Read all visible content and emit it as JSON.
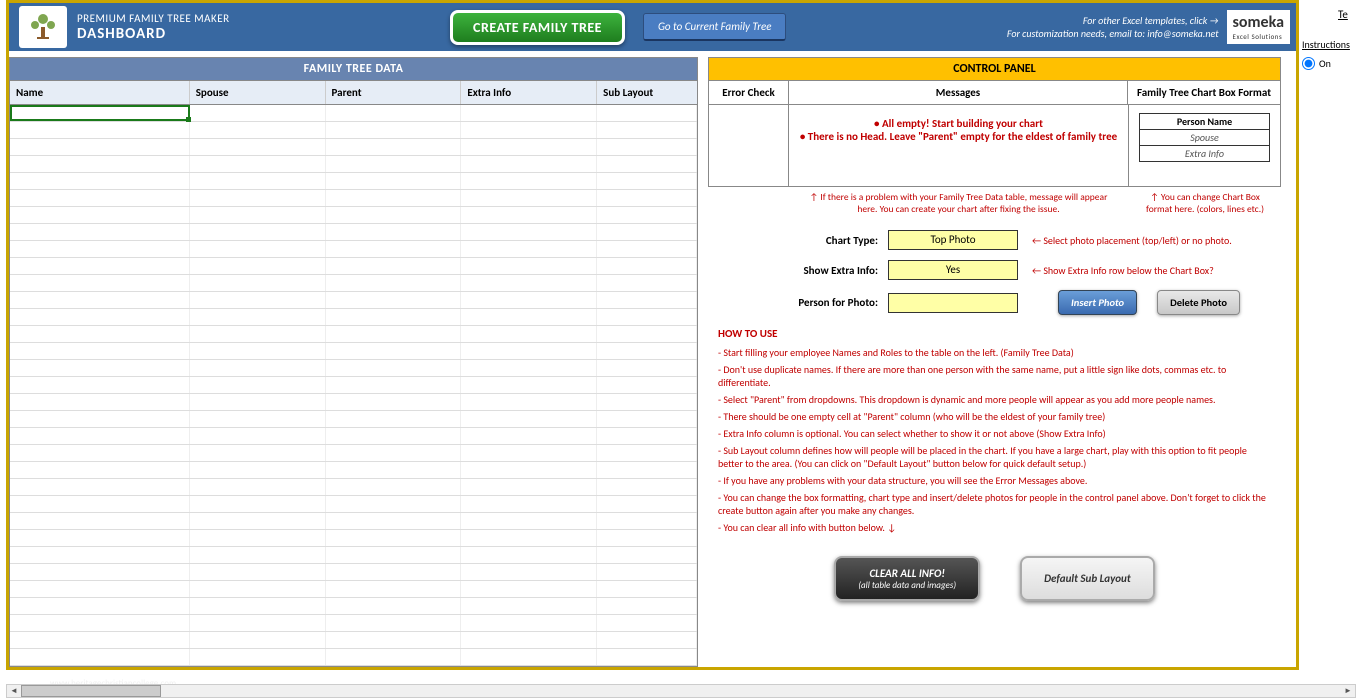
{
  "header": {
    "subtitle": "PREMIUM FAMILY TREE MAKER",
    "title": "DASHBOARD",
    "create_btn": "CREATE FAMILY TREE",
    "goto_btn": "Go to Current Family Tree",
    "other_templates": "For other Excel templates, click →",
    "customization": "For customization needs, email to: info@someka.net",
    "brand": "someka",
    "brand_sub": "Excel Solutions"
  },
  "left": {
    "title": "FAMILY TREE DATA",
    "cols": {
      "name": "Name",
      "spouse": "Spouse",
      "parent": "Parent",
      "extra": "Extra Info",
      "sub": "Sub Layout"
    }
  },
  "right": {
    "title": "CONTROL PANEL",
    "cols": {
      "err": "Error Check",
      "msg": "Messages",
      "fmt": "Family Tree Chart Box Format"
    },
    "msg1": "• All empty! Start building your chart",
    "msg2": "• There is no Head. Leave \"Parent\" empty for the eldest of family tree",
    "fmt_rows": {
      "r1": "Person Name",
      "r2": "Spouse",
      "r3": "Extra Info"
    },
    "hint_l": "↑",
    "hint_m": "↑  If there is a problem with your Family Tree Data table, message will appear here. You can create your chart after fixing the issue.",
    "hint_r": "↑ You can change Chart Box format here. (colors, lines etc.)",
    "chart_type_label": "Chart Type:",
    "chart_type_value": "Top Photo",
    "chart_type_hint": "←  Select photo placement (top/left) or no photo.",
    "show_extra_label": "Show Extra Info:",
    "show_extra_value": "Yes",
    "show_extra_hint": "←  Show Extra Info row below the Chart Box?",
    "person_photo_label": "Person for Photo:",
    "person_photo_value": "",
    "insert_photo_btn": "Insert Photo",
    "delete_photo_btn": "Delete Photo",
    "howto_title": "HOW TO USE",
    "howto": {
      "p1": "- Start filling your employee Names and Roles to the table on the left. (Family Tree Data)",
      "p2": "- Don't use duplicate names. If there are more than one person with the same name, put a little sign like dots, commas etc. to differentiate.",
      "p3": "- Select \"Parent\" from dropdowns. This dropdown is dynamic and more people will appear as you add more people names.",
      "p4": "- There should be one empty cell at \"Parent\" column (who will be the eldest of your family tree)",
      "p5": "- Extra Info column is optional. You can select whether to show it or not above (Show Extra Info)",
      "p6": "- Sub Layout column defines how will people will be placed in the chart. If you have a large chart, play with this option to fit people better to the area. (You can click on \"Default Layout\" button below for quick default setup.)",
      "p7": "- If you have any problems with your data structure, you will see the Error Messages above.",
      "p8": "- You can change the box formatting, chart type and insert/delete photos for people in the control panel above. Don't forget to click the create button again after you make any changes.",
      "p9": "- You can clear all info with button below. ↓"
    },
    "clear_btn": "CLEAR ALL INFO!",
    "clear_sub": "(all table data and images)",
    "default_btn": "Default Sub Layout"
  },
  "side": {
    "te": "Te",
    "instructions": "Instructions",
    "on": "On"
  },
  "watermark": "www.heritagechristiancollege.com"
}
